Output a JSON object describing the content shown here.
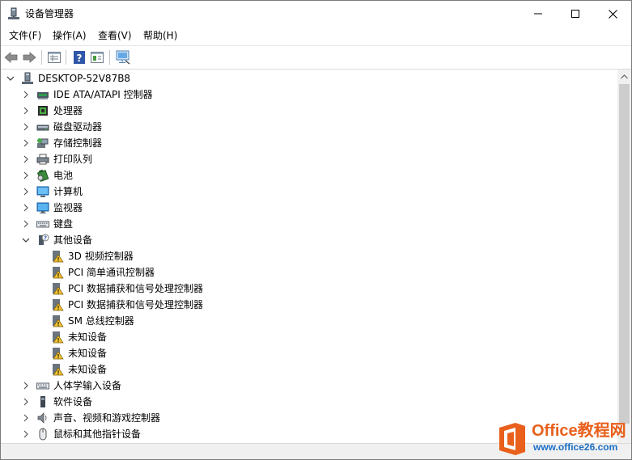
{
  "window": {
    "title": "设备管理器",
    "minimize_glyph": "—",
    "close_glyph": "✕"
  },
  "menu": [
    {
      "label": "文件(F)"
    },
    {
      "label": "操作(A)"
    },
    {
      "label": "查看(V)"
    },
    {
      "label": "帮助(H)"
    }
  ],
  "toolbar": {
    "buttons": [
      "back-icon",
      "forward-icon",
      "properties-icon",
      "help-icon",
      "view-icon",
      "monitor-scan-icon"
    ]
  },
  "tree": {
    "root": {
      "label": "DESKTOP-52V87B8",
      "icon": "computer-tower-icon"
    },
    "items": [
      {
        "label": "IDE ATA/ATAPI 控制器",
        "icon": "ide-controller-icon"
      },
      {
        "label": "处理器",
        "icon": "processor-icon"
      },
      {
        "label": "磁盘驱动器",
        "icon": "disk-drive-icon"
      },
      {
        "label": "存储控制器",
        "icon": "storage-controller-icon"
      },
      {
        "label": "打印队列",
        "icon": "printer-icon"
      },
      {
        "label": "电池",
        "icon": "battery-icon"
      },
      {
        "label": "计算机",
        "icon": "computer-icon"
      },
      {
        "label": "监视器",
        "icon": "monitor-icon"
      },
      {
        "label": "键盘",
        "icon": "keyboard-icon"
      },
      {
        "label": "其他设备",
        "icon": "other-devices-icon",
        "expanded": true,
        "children": [
          {
            "label": "3D 视频控制器",
            "icon": "warning-device-icon"
          },
          {
            "label": "PCI 简单通讯控制器",
            "icon": "warning-device-icon"
          },
          {
            "label": "PCI 数据捕获和信号处理控制器",
            "icon": "warning-device-icon"
          },
          {
            "label": "PCI 数据捕获和信号处理控制器",
            "icon": "warning-device-icon"
          },
          {
            "label": "SM 总线控制器",
            "icon": "warning-device-icon"
          },
          {
            "label": "未知设备",
            "icon": "warning-device-icon"
          },
          {
            "label": "未知设备",
            "icon": "warning-device-icon"
          },
          {
            "label": "未知设备",
            "icon": "warning-device-icon"
          }
        ]
      },
      {
        "label": "人体学输入设备",
        "icon": "hid-icon"
      },
      {
        "label": "软件设备",
        "icon": "software-device-icon"
      },
      {
        "label": "声音、视频和游戏控制器",
        "icon": "sound-icon"
      },
      {
        "label": "鼠标和其他指针设备",
        "icon": "mouse-icon"
      }
    ]
  },
  "watermark": {
    "brand": "Office教程网",
    "url": "www.office26.com"
  }
}
